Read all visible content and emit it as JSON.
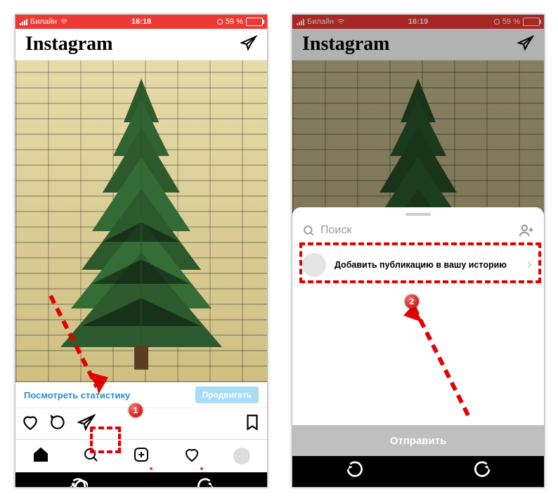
{
  "status": {
    "carrier": "Билайн",
    "time1": "16:18",
    "time2": "16:19",
    "battery": "59 %"
  },
  "header": {
    "logo": "Instagram"
  },
  "post": {
    "stats_link": "Посмотреть статистику",
    "promote": "Продвигать"
  },
  "sheet": {
    "search_placeholder": "Поиск",
    "add_story": "Добавить публикацию в вашу историю",
    "send": "Отправить"
  },
  "badge": {
    "one": "1",
    "two": "2"
  }
}
